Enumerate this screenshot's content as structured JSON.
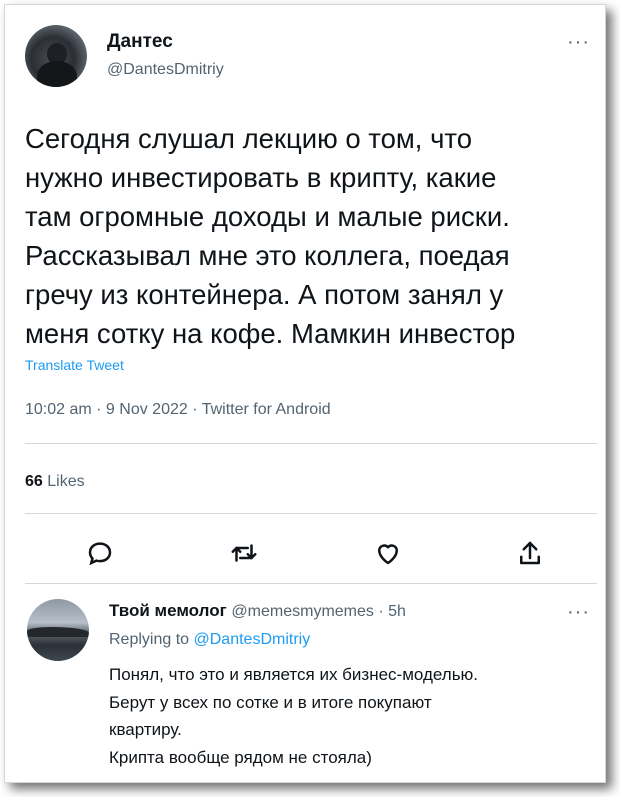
{
  "tweet": {
    "author_name": "Дантес",
    "author_handle": "@DantesDmitriy",
    "more_label": "···",
    "text": "Сегодня слушал лекцию о том, что\nнужно инвестировать в крипту, какие\nтам огромные доходы и малые риски.\nРассказывал мне это коллега, поедая\nгречу из контейнера. А потом занял у\nменя сотку на кофе. Мамкин инвестор",
    "translate_label": "Translate Tweet",
    "timestamp": "10:02 am · 9 Nov 2022 · Twitter for Android",
    "likes_count": "66",
    "likes_label": "Likes",
    "actions": [
      "reply-icon",
      "retweet-icon",
      "like-icon",
      "share-icon"
    ]
  },
  "reply": {
    "author_name": "Твой мемолог",
    "author_handle": "@memesmymemes · 5h",
    "more_label": "···",
    "replying_prefix": "Replying to",
    "replying_to": "@DantesDmitriy",
    "lines": [
      "Понял, что это и является их бизнес-моделью.",
      "Берут у всех по сотке и в итоге покупают",
      "квартиру.",
      "Крипта вообще рядом не стояла)"
    ]
  },
  "colors": {
    "text": "#0f1419",
    "secondary": "#536471",
    "link": "#1d9bf0",
    "divider": "#cfd9de"
  }
}
